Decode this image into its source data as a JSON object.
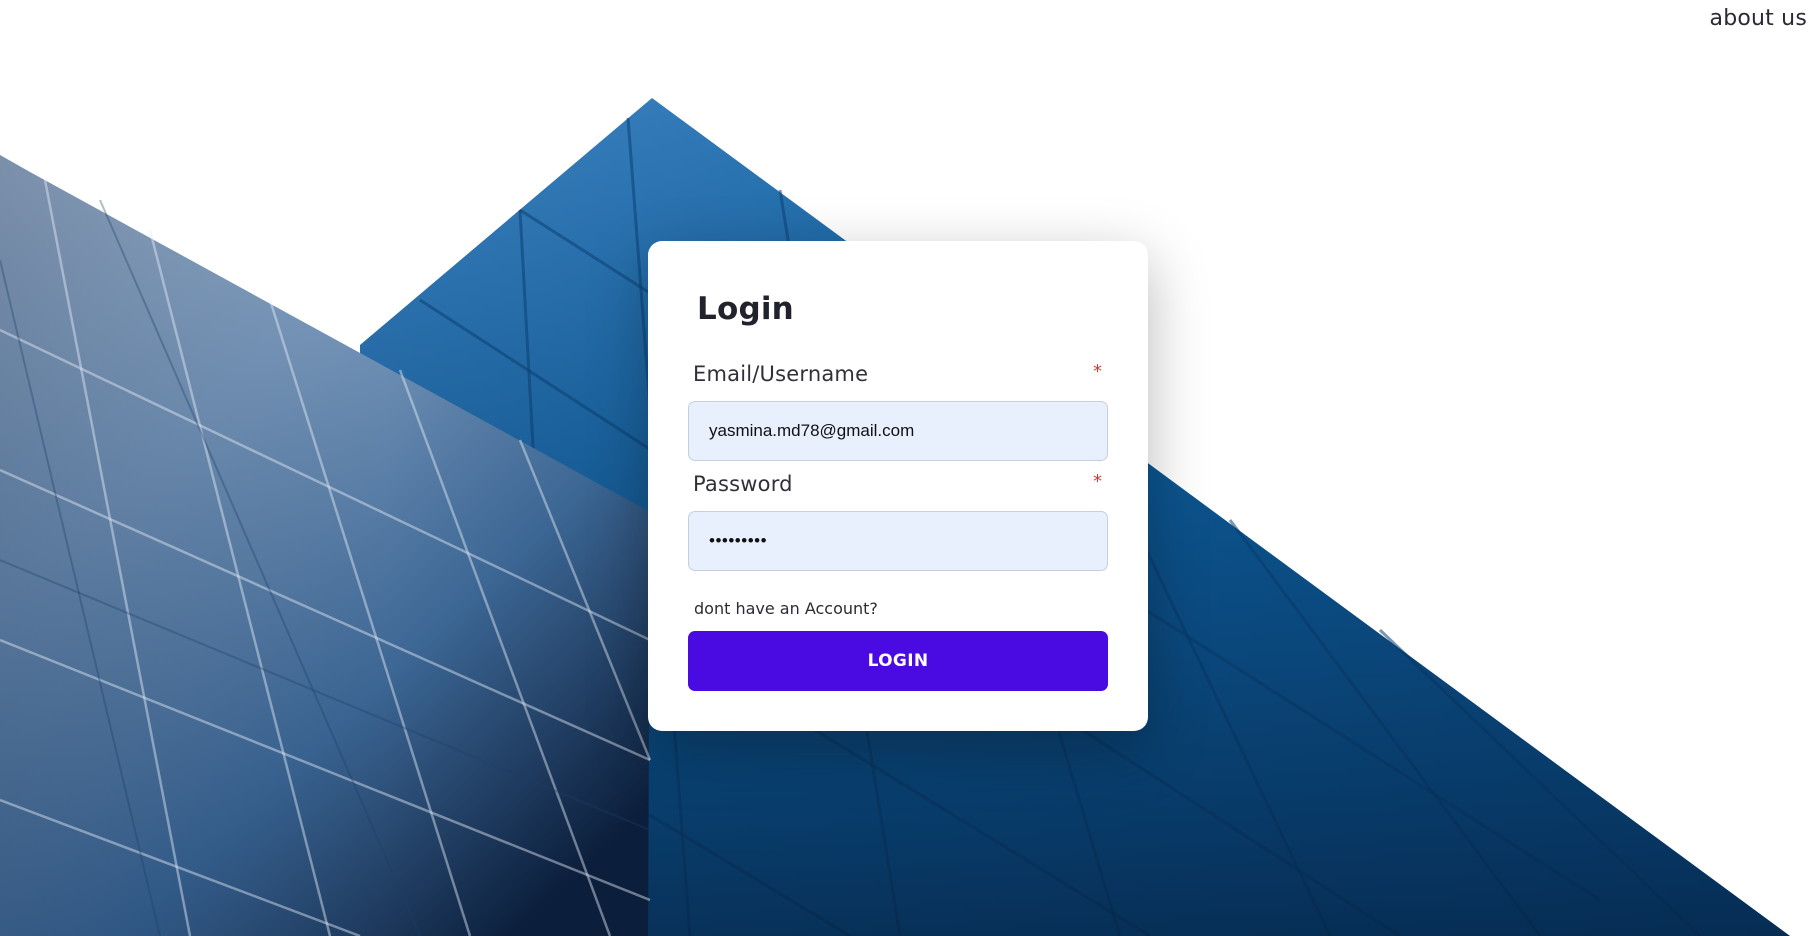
{
  "header": {
    "about_label": "about us"
  },
  "login_form": {
    "title": "Login",
    "email": {
      "label": "Email/Username",
      "required_mark": "*",
      "value": "yasmina.md78@gmail.com"
    },
    "password": {
      "label": "Password",
      "required_mark": "*",
      "value": "•••••••••"
    },
    "signup_link": "dont have an Account?",
    "submit_label": "LOGIN"
  },
  "colors": {
    "accent": "#4a0be3",
    "input_background": "#e8f0fe",
    "required": "#d23b2b"
  }
}
